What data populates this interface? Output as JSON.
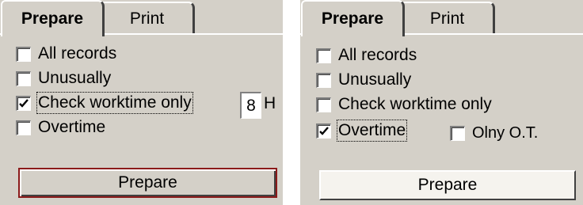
{
  "left": {
    "tabs": {
      "active": "Prepare",
      "inactive": "Print"
    },
    "options": [
      {
        "label": "All records",
        "checked": false
      },
      {
        "label": "Unusually",
        "checked": false
      },
      {
        "label": "Check worktime only",
        "checked": true
      },
      {
        "label": "Overtime",
        "checked": false
      }
    ],
    "hours_value": "8",
    "hours_unit": "H",
    "button_label": "Prepare"
  },
  "right": {
    "tabs": {
      "active": "Prepare",
      "inactive": "Print"
    },
    "options": [
      {
        "label": "All records",
        "checked": false
      },
      {
        "label": "Unusually",
        "checked": false
      },
      {
        "label": "Check worktime only",
        "checked": false
      },
      {
        "label": "Overtime",
        "checked": true
      }
    ],
    "only_ot_label": "Olny O.T.",
    "only_ot_checked": false,
    "button_label": "Prepare"
  }
}
